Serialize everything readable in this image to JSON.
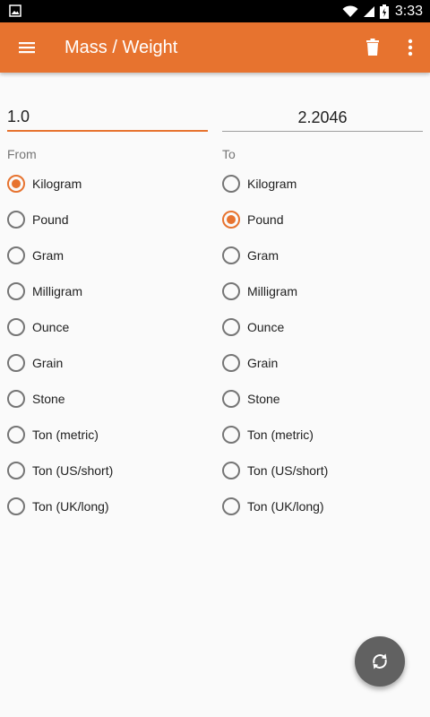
{
  "status_bar": {
    "time": "3:33",
    "icons": [
      "gallery-icon",
      "wifi-icon",
      "signal-icon",
      "battery-icon"
    ]
  },
  "app_bar": {
    "title": "Mass / Weight",
    "icons": [
      "menu-icon",
      "delete-icon",
      "more-vert-icon"
    ]
  },
  "from": {
    "value": "1.0",
    "label": "From",
    "units": [
      "Kilogram",
      "Pound",
      "Gram",
      "Milligram",
      "Ounce",
      "Grain",
      "Stone",
      "Ton (metric)",
      "Ton (US/short)",
      "Ton (UK/long)"
    ],
    "selected": "Kilogram"
  },
  "to": {
    "value": "2.2046",
    "label": "To",
    "units": [
      "Kilogram",
      "Pound",
      "Gram",
      "Milligram",
      "Ounce",
      "Grain",
      "Stone",
      "Ton (metric)",
      "Ton (US/short)",
      "Ton (UK/long)"
    ],
    "selected": "Pound"
  },
  "fab": {
    "icon": "swap-icon"
  },
  "colors": {
    "accent": "#e7732f",
    "fab": "#616161",
    "background": "#fafafa"
  }
}
